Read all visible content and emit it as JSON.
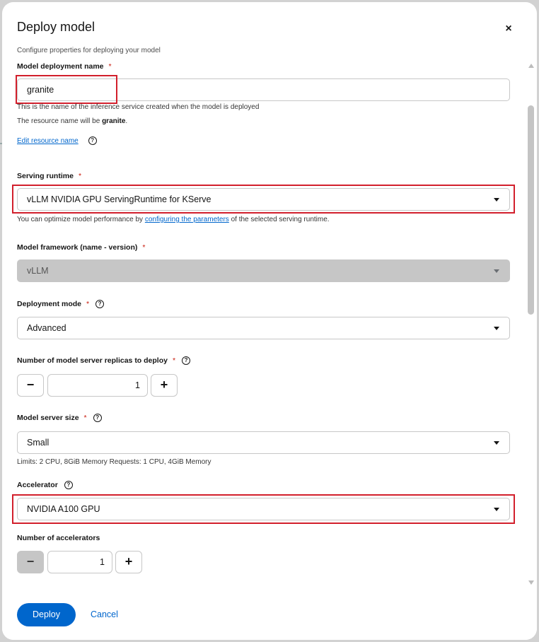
{
  "modal": {
    "title": "Deploy model",
    "close_label": "×",
    "description": "Configure properties for deploying your model"
  },
  "deployment_name": {
    "label": "Model deployment name",
    "required": "*",
    "value": "granite",
    "helper": "This is the name of the inference service created when the model is deployed",
    "resource_prefix": "The resource name will be ",
    "resource_name": "granite",
    "resource_suffix": ".",
    "edit_link": "Edit resource name"
  },
  "serving_runtime": {
    "label": "Serving runtime",
    "required": "*",
    "value": "vLLM NVIDIA GPU ServingRuntime for KServe",
    "helper_prefix": "You can optimize model performance by ",
    "helper_link": "configuring the parameters",
    "helper_suffix": " of the selected serving runtime."
  },
  "model_framework": {
    "label": "Model framework (name - version)",
    "required": "*",
    "value": "vLLM"
  },
  "deployment_mode": {
    "label": "Deployment mode",
    "required": "*",
    "value": "Advanced"
  },
  "replicas": {
    "label": "Number of model server replicas to deploy",
    "required": "*",
    "minus": "−",
    "value": "1",
    "plus": "+"
  },
  "server_size": {
    "label": "Model server size",
    "required": "*",
    "value": "Small",
    "helper": "Limits: 2 CPU, 8GiB Memory Requests: 1 CPU, 4GiB Memory"
  },
  "accelerator": {
    "label": "Accelerator",
    "value": "NVIDIA A100 GPU"
  },
  "accelerators_count": {
    "label": "Number of accelerators",
    "minus": "−",
    "value": "1",
    "plus": "+"
  },
  "help_glyph": "?",
  "footer": {
    "deploy_label": "Deploy",
    "cancel_label": "Cancel"
  },
  "colors": {
    "primary": "#0066cc",
    "highlight": "#d21f2c",
    "required": "#c9190b"
  }
}
